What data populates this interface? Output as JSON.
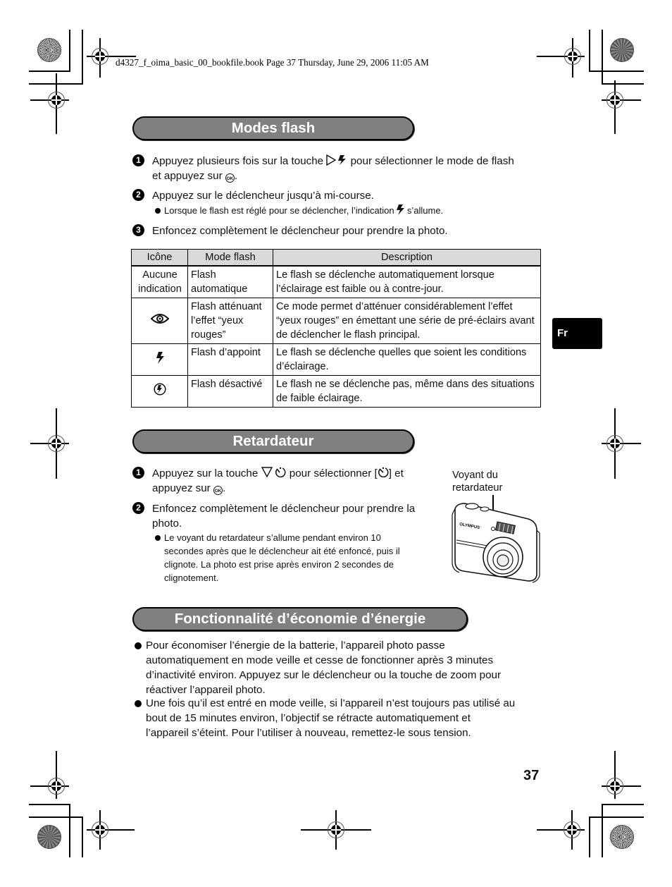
{
  "print_header": "d4327_f_oima_basic_00_bookfile.book  Page 37  Thursday, June 29, 2006  11:05 AM",
  "sections": {
    "flash": {
      "title": "Modes flash",
      "steps": [
        {
          "num": "1",
          "text_before": "Appuyez plusieurs fois sur la touche",
          "text_after": "pour sélectionner le mode de flash",
          "line2_before": "et appuyez sur",
          "line2_after": "."
        },
        {
          "num": "2",
          "text": "Appuyez sur le déclencheur jusqu’à mi-course.",
          "note_before": "Lorsque le flash est réglé pour se déclencher, l’indication",
          "note_after": "s’allume."
        },
        {
          "num": "3",
          "text": "Enfoncez complètement le déclencheur pour prendre la photo."
        }
      ],
      "table": {
        "headers": [
          "Icône",
          "Mode flash",
          "Description"
        ],
        "rows": [
          {
            "icon": "none",
            "icon_text": "Aucune indication",
            "mode": "Flash automatique",
            "description": "Le flash se déclenche automatiquement lorsque l’éclairage est faible ou à contre-jour."
          },
          {
            "icon": "red-eye-icon",
            "icon_text": "",
            "mode": "Flash atténuant l’effet “yeux rouges”",
            "description": "Ce mode permet d’atténuer considérablement l’effet “yeux rouges” en émettant une série de pré-éclairs avant de déclencher le flash principal."
          },
          {
            "icon": "flash-icon",
            "icon_text": "",
            "mode": "Flash d’appoint",
            "description": "Le flash se déclenche quelles que soient les conditions d’éclairage."
          },
          {
            "icon": "flash-off-icon",
            "icon_text": "",
            "mode": "Flash désactivé",
            "description": "Le flash ne se déclenche pas, même dans des situations de faible éclairage."
          }
        ]
      }
    },
    "timer": {
      "title": "Retardateur",
      "steps": [
        {
          "num": "1",
          "line1_before": "Appuyez sur la touche",
          "line1_mid": "pour sélectionner [",
          "line1_after": "] et",
          "line2_before": "appuyez sur",
          "line2_after": "."
        },
        {
          "num": "2",
          "line1": "Enfoncez complètement le déclencheur pour prendre la",
          "line2": "photo.",
          "note": [
            "Le voyant du retardateur s’allume pendant environ 10",
            "secondes après que le déclencheur ait été enfoncé, puis il",
            "clignote. La photo est prise après environ 2 secondes de",
            "clignotement."
          ]
        }
      ],
      "camera_label": [
        "Voyant du",
        "retardateur"
      ],
      "camera_brand": "OLYMPUS"
    },
    "power": {
      "title": "Fonctionnalité d’économie d’énergie",
      "bullets": [
        [
          "Pour économiser l’énergie de la batterie, l’appareil photo passe",
          "automatiquement en mode veille et cesse de fonctionner après 3 minutes",
          "d’inactivité environ. Appuyez sur le déclencheur ou la touche de zoom pour",
          "réactiver l’appareil photo."
        ],
        [
          "Une fois qu’il est entré en mode veille, si l’appareil n’est toujours pas utilisé au",
          "bout de 15 minutes environ, l’objectif se rétracte automatiquement et",
          "l’appareil s’éteint. Pour l’utiliser à nouveau, remettez-le sous tension."
        ]
      ]
    }
  },
  "ok_label": "OK",
  "language_tab": "Fr",
  "page_number": "37"
}
